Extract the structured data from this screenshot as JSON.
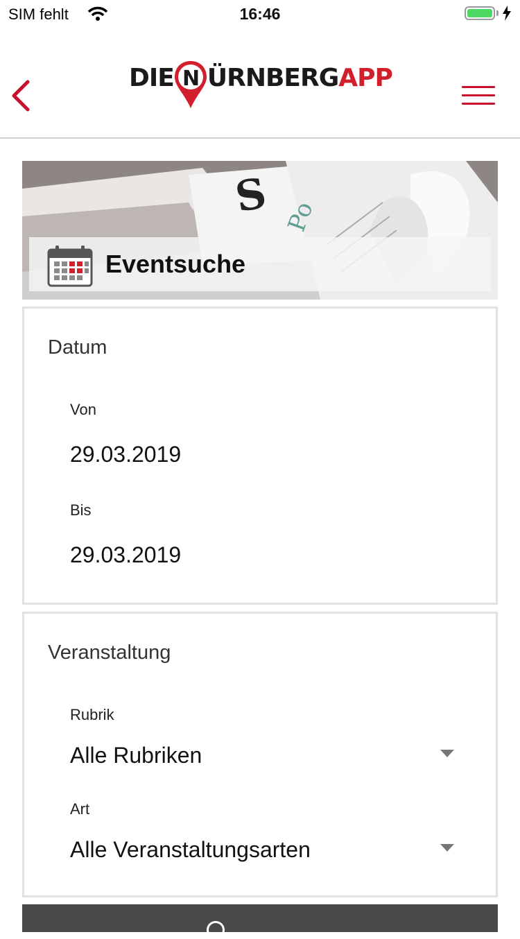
{
  "status": {
    "carrier": "SIM fehlt",
    "time": "16:46"
  },
  "header": {
    "logo_die": "DIE",
    "logo_n": "N",
    "logo_urnberg": "ÜRNBERG",
    "logo_app": "APP",
    "back_icon": "chevron-left-icon",
    "menu_icon": "hamburger-icon",
    "accent": "#c8102e"
  },
  "banner": {
    "title": "Eventsuche",
    "icon": "calendar-icon"
  },
  "datum": {
    "title": "Datum",
    "from_label": "Von",
    "from_value": "29.03.2019",
    "to_label": "Bis",
    "to_value": "29.03.2019"
  },
  "veranstaltung": {
    "title": "Veranstaltung",
    "rubrik_label": "Rubrik",
    "rubrik_value": "Alle Rubriken",
    "art_label": "Art",
    "art_value": "Alle Veranstaltungsarten"
  },
  "search": {
    "icon": "search-icon"
  }
}
